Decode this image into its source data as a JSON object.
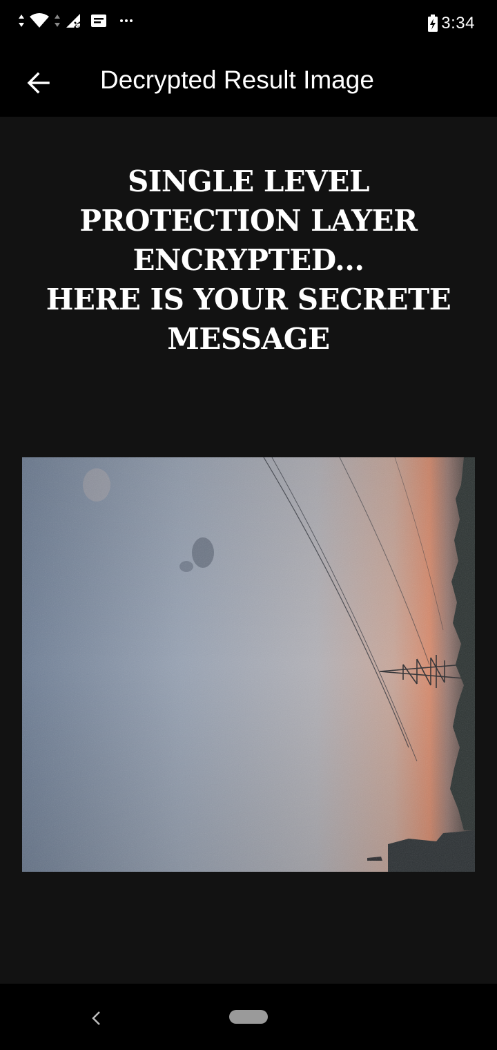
{
  "status_bar": {
    "time": "3:34",
    "icons": [
      "data-arrows-icon",
      "wifi-icon",
      "data-arrows-icon",
      "signal-no-data-icon",
      "notification-message-icon",
      "more-notifications-icon",
      "battery-charging-icon"
    ]
  },
  "app_bar": {
    "title": "Decrypted Result Image",
    "back_icon": "arrow-left-icon"
  },
  "message": {
    "lines": [
      "SINGLE LEVEL",
      "PROTECTION LAYER",
      "ENCRYPTED...",
      "HERE IS YOUR SECRETE",
      "MESSAGE"
    ]
  },
  "nav_bar": {
    "back_icon": "chevron-left-icon",
    "home_icon": "home-pill-icon"
  },
  "colors": {
    "background": "#121212",
    "bar": "#000000",
    "text": "#ffffff"
  }
}
